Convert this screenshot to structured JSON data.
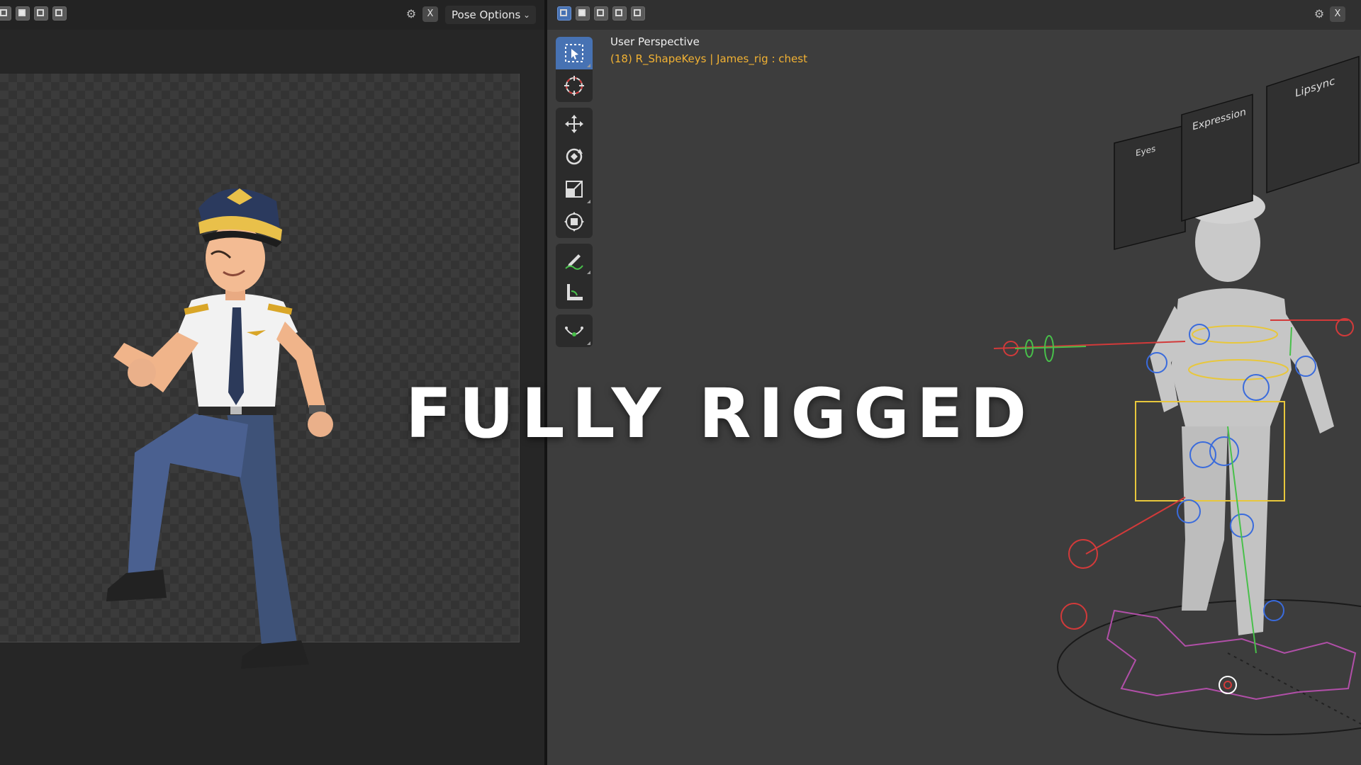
{
  "left_panel": {
    "pose_options_label": "Pose Options",
    "close_label": "X"
  },
  "right_panel": {
    "close_label": "X",
    "viewport": {
      "title": "User Perspective",
      "context": "(18) R_ShapeKeys | James_rig : chest"
    },
    "tools": [
      {
        "name": "select-box-icon",
        "active": true
      },
      {
        "name": "cursor-icon"
      },
      {
        "name": "move-icon"
      },
      {
        "name": "rotate-icon"
      },
      {
        "name": "scale-icon"
      },
      {
        "name": "transform-icon"
      },
      {
        "name": "annotate-icon"
      },
      {
        "name": "measure-icon"
      },
      {
        "name": "roll-icon"
      }
    ],
    "rig_panels": {
      "eyes_title": "Eyes",
      "expression_title": "Expression",
      "lipsync_title": "Lipsync"
    }
  },
  "overlay": {
    "title": "FULLY RIGGED"
  },
  "colors": {
    "accent": "#4772b3",
    "context_text": "#f2b233",
    "viewport_bg": "#3d3d3d"
  }
}
